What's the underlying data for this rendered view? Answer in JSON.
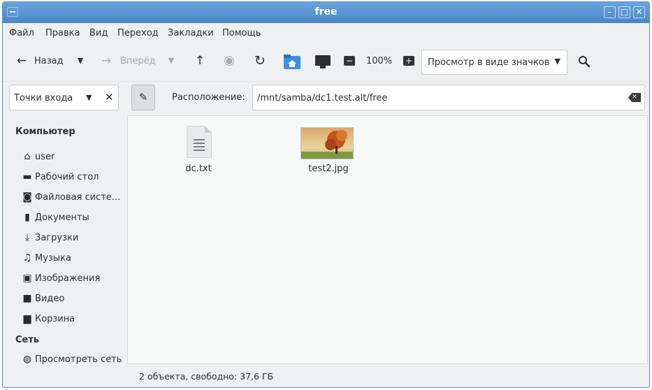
{
  "window": {
    "title": "free"
  },
  "menu": [
    "Файл",
    "Правка",
    "Вид",
    "Переход",
    "Закладки",
    "Помощь"
  ],
  "toolbar": {
    "back_label": "Назад",
    "forward_label": "Вперёд",
    "zoom": "100%",
    "view_mode": "Просмотр в виде значков"
  },
  "location": {
    "places_label": "Точки входа",
    "label": "Расположение:",
    "path": "/mnt/samba/dc1.test.alt/free"
  },
  "sidebar": {
    "computer_header": "Компьютер",
    "items": [
      {
        "label": "user",
        "icon": "home-icon"
      },
      {
        "label": "Рабочий стол",
        "icon": "desktop-icon"
      },
      {
        "label": "Файловая систе...",
        "icon": "filesystem-icon"
      },
      {
        "label": "Документы",
        "icon": "documents-icon"
      },
      {
        "label": "Загрузки",
        "icon": "downloads-icon"
      },
      {
        "label": "Музыка",
        "icon": "music-icon"
      },
      {
        "label": "Изображения",
        "icon": "pictures-icon"
      },
      {
        "label": "Видео",
        "icon": "video-icon"
      },
      {
        "label": "Корзина",
        "icon": "trash-icon"
      }
    ],
    "network_header": "Сеть",
    "network_items": [
      {
        "label": "Просмотреть сеть",
        "icon": "network-icon"
      }
    ]
  },
  "files": [
    {
      "name": "dc.txt",
      "icon": "text-file-icon"
    },
    {
      "name": "test2.jpg",
      "icon": "image-thumbnail"
    }
  ],
  "status": {
    "text": "2 объекта, свободно: 37,6 ГБ"
  },
  "colors": {
    "titlebar": "#4a86c8",
    "folder_accent": "#3d8fe0"
  }
}
